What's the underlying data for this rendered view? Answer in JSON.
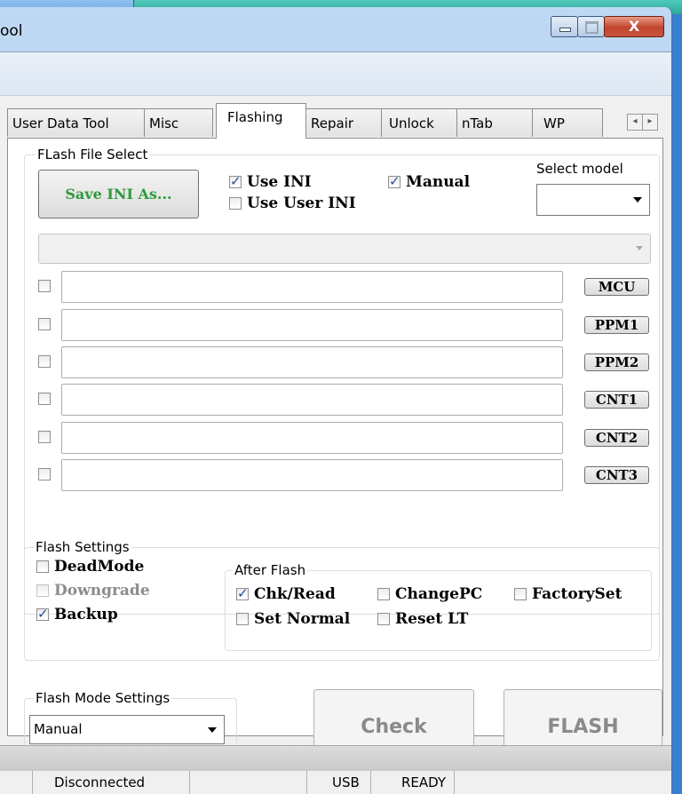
{
  "window": {
    "title": "ool"
  },
  "tabs": [
    {
      "label": "User Data Tool"
    },
    {
      "label": "Misc"
    },
    {
      "label": "Flashing"
    },
    {
      "label": "Repair"
    },
    {
      "label": "Unlock"
    },
    {
      "label": "nTab"
    },
    {
      "label": "WP"
    }
  ],
  "flash_file": {
    "legend": "FLash File Select",
    "save_ini_label": "Save INI As...",
    "use_ini": {
      "label": "Use INI",
      "checked": true
    },
    "use_user_ini": {
      "label": "Use User INI",
      "checked": false
    },
    "manual": {
      "label": "Manual",
      "checked": true
    },
    "select_model_label": "Select model",
    "select_model_value": "",
    "rows": [
      {
        "tag": "MCU"
      },
      {
        "tag": "PPM1"
      },
      {
        "tag": "PPM2"
      },
      {
        "tag": "CNT1"
      },
      {
        "tag": "CNT2"
      },
      {
        "tag": "CNT3"
      }
    ]
  },
  "flash_settings": {
    "legend": "Flash Settings",
    "deadmode": {
      "label": "DeadMode",
      "checked": false
    },
    "downgrade": {
      "label": "Downgrade",
      "checked": false,
      "disabled": true
    },
    "backup": {
      "label": "Backup",
      "checked": true
    },
    "after_flash": {
      "legend": "After Flash",
      "chk_read": {
        "label": "Chk/Read",
        "checked": true
      },
      "change_pc": {
        "label": "ChangePC",
        "checked": false
      },
      "factory_set": {
        "label": "FactorySet",
        "checked": false
      },
      "set_normal": {
        "label": "Set Normal",
        "checked": false
      },
      "reset_lt": {
        "label": "Reset LT",
        "checked": false
      }
    }
  },
  "flash_mode": {
    "legend": "Flash Mode Settings",
    "value": "Manual"
  },
  "actions": {
    "check_label": "Check",
    "flash_label": "FLASH"
  },
  "status": {
    "connection": "Disconnected",
    "port": "USB",
    "state": "READY"
  },
  "colors": {
    "save_ini_text": "#2e9a3a",
    "title_bar": "#a9c9ec"
  }
}
